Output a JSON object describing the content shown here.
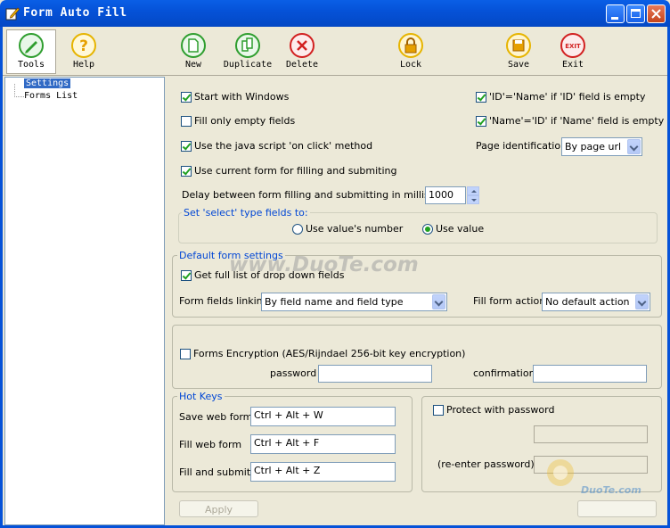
{
  "window": {
    "title": "Form Auto Fill"
  },
  "toolbar": {
    "tools": "Tools",
    "help": "Help",
    "new": "New",
    "duplicate": "Duplicate",
    "delete": "Delete",
    "lock": "Lock",
    "save": "Save",
    "exit": "Exit",
    "exit_icon_text": "EXIT"
  },
  "tree": {
    "settings": "Settings",
    "forms_list": "Forms List"
  },
  "general": {
    "start_with_windows": "Start with Windows",
    "fill_only_empty": "Fill only empty fields",
    "use_js_onclick": "Use the java script 'on click' method",
    "use_current_form": "Use current form for filling and submiting",
    "id_name": "'ID'='Name' if 'ID' field is empty",
    "name_id": "'Name'='ID' if 'Name' field is empty",
    "page_identification_label": "Page identification",
    "page_identification_value": "By page url",
    "delay_label": "Delay between form filling and submitting in milliseconds",
    "delay_value": "1000",
    "select_group_title": "Set 'select' type fields to:",
    "use_value_number": "Use value's number",
    "use_value": "Use value"
  },
  "default_form": {
    "title": "Default form settings",
    "get_full_list": "Get full list of drop down fields",
    "linking_label": "Form fields linking",
    "linking_value": "By field name and field type",
    "fill_action_label": "Fill form action",
    "fill_action_value": "No default action"
  },
  "encryption": {
    "label": "Forms Encryption (AES/Rijndael 256-bit key encryption)",
    "password_label": "password",
    "confirmation_label": "confirmation"
  },
  "hotkeys": {
    "title": "Hot Keys",
    "save_label": "Save web form",
    "save_value": "Ctrl + Alt + W",
    "fill_label": "Fill web form",
    "fill_value": "Ctrl + Alt + F",
    "submit_label": "Fill and submit",
    "submit_value": "Ctrl + Alt + Z"
  },
  "protect": {
    "label": "Protect with password",
    "reenter_label": "(re-enter password)"
  },
  "buttons": {
    "apply": "Apply"
  },
  "watermarks": {
    "center": "www.DuoTe.com",
    "brand": "DuoTe.com"
  },
  "colors": {
    "titlebar": "#0552d8",
    "selection": "#316ac5",
    "group_title": "#0046d5"
  }
}
